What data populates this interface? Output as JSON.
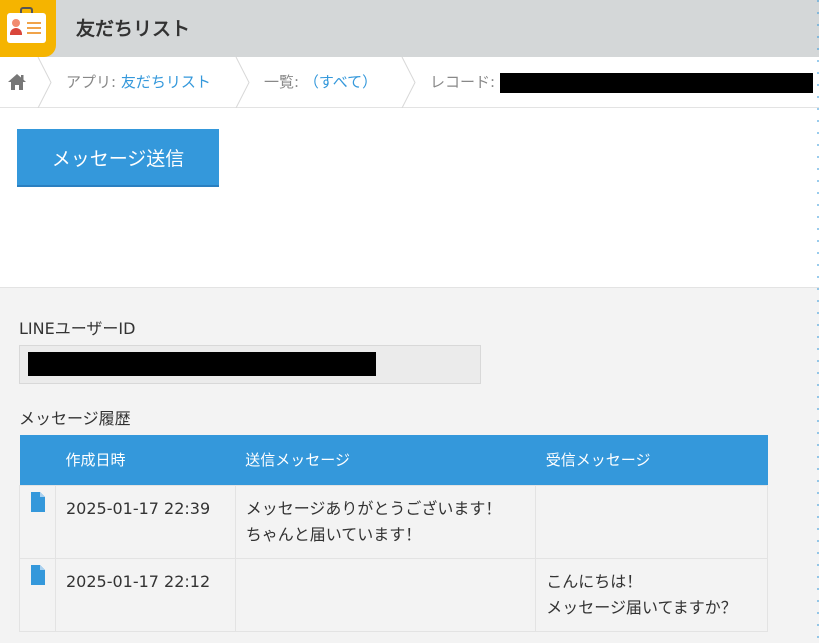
{
  "header": {
    "title": "友だちリスト"
  },
  "breadcrumb": {
    "app_prefix": "アプリ: ",
    "app_name": "友だちリスト",
    "list_prefix": "一覧: ",
    "list_name": "（すべて）",
    "record_prefix": "レコード: "
  },
  "actions": {
    "send_message": "メッセージ送信"
  },
  "fields": {
    "line_user_id_label": "LINEユーザーID",
    "history_label": "メッセージ履歴"
  },
  "history": {
    "columns": [
      "作成日時",
      "送信メッセージ",
      "受信メッセージ"
    ],
    "rows": [
      {
        "created": "2025-01-17 22:39",
        "sent_line1": "メッセージありがとうございます！",
        "sent_line2": "ちゃんと届いています！",
        "received_line1": "",
        "received_line2": ""
      },
      {
        "created": "2025-01-17 22:12",
        "sent_line1": "",
        "sent_line2": "",
        "received_line1": "こんにちは！",
        "received_line2": "メッセージ届いてますか？"
      }
    ]
  },
  "colors": {
    "accent": "#3498db",
    "header_bg": "#d4d7d8",
    "app_icon_bg": "#f5b400"
  },
  "icons": {
    "home": "home-icon",
    "app": "contact-card-icon",
    "row": "document-icon"
  }
}
